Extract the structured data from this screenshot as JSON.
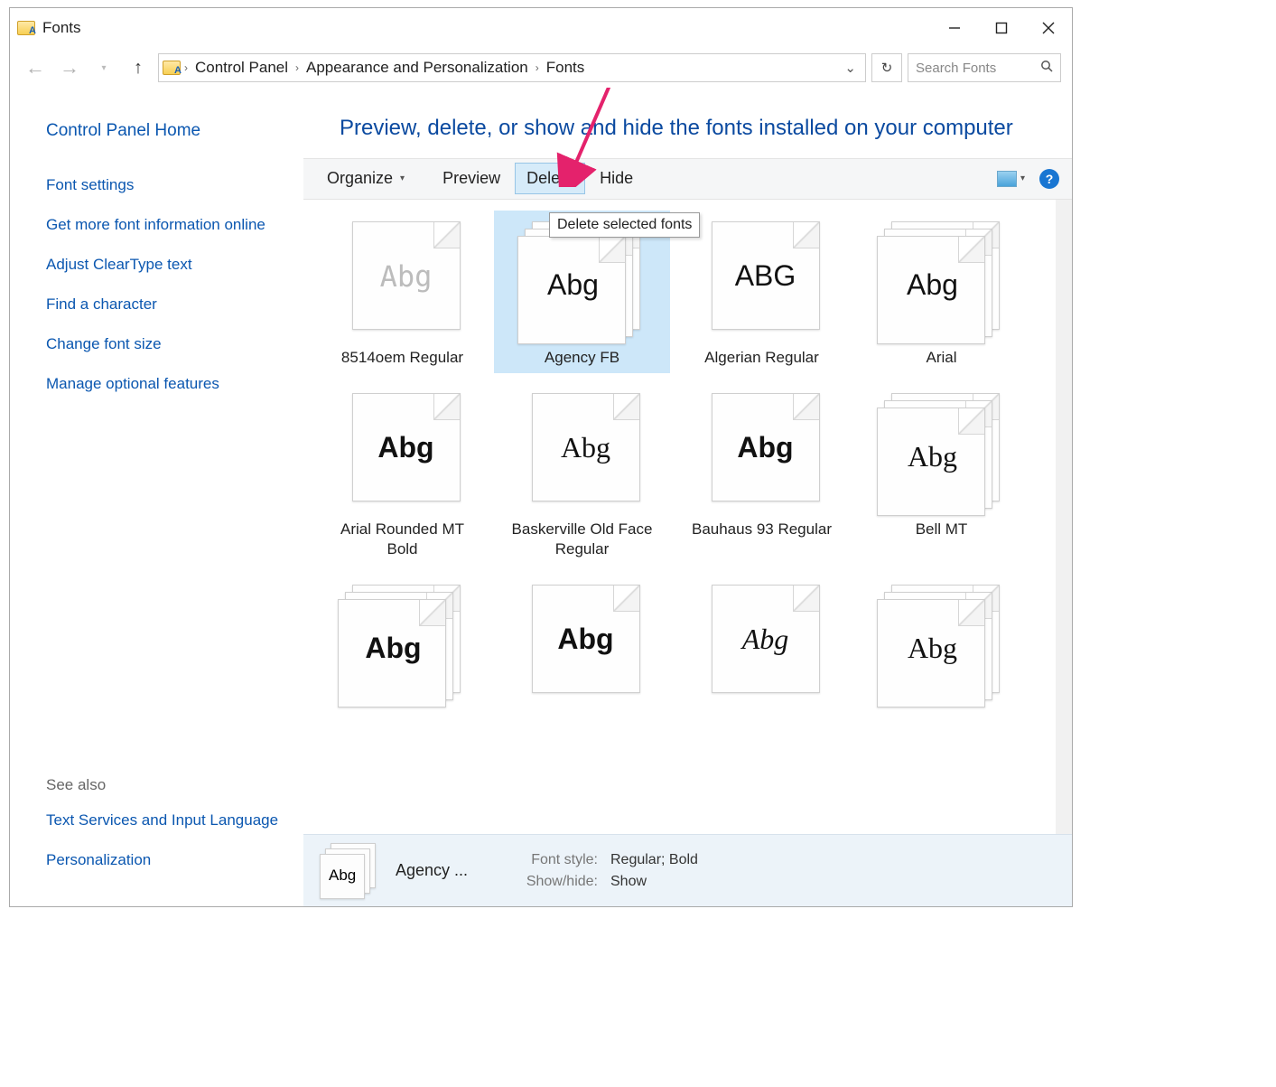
{
  "window": {
    "title": "Fonts"
  },
  "breadcrumbs": [
    "Control Panel",
    "Appearance and Personalization",
    "Fonts"
  ],
  "search": {
    "placeholder": "Search Fonts"
  },
  "page_heading": "Preview, delete, or show and hide the fonts installed on your computer",
  "sidebar": {
    "home": "Control Panel Home",
    "links": [
      "Font settings",
      "Get more font information online",
      "Adjust ClearType text",
      "Find a character",
      "Change font size",
      "Manage optional features"
    ],
    "see_also_label": "See also",
    "see_also": [
      "Text Services and Input Language",
      "Personalization"
    ]
  },
  "toolbar": {
    "organize": "Organize",
    "preview": "Preview",
    "delete": "Delete",
    "hide": "Hide"
  },
  "tooltip": "Delete selected fonts",
  "fonts": [
    {
      "name": "8514oem Regular",
      "sample": "Abg",
      "stack": false,
      "dim": true
    },
    {
      "name": "Agency FB",
      "sample": "Abg",
      "stack": true,
      "selected": true
    },
    {
      "name": "Algerian Regular",
      "sample": "ABG",
      "stack": false
    },
    {
      "name": "Arial",
      "sample": "Abg",
      "stack": true
    },
    {
      "name": "Arial Rounded MT Bold",
      "sample": "Abg",
      "stack": false,
      "bold": true
    },
    {
      "name": "Baskerville Old Face Regular",
      "sample": "Abg",
      "stack": false,
      "serif": true
    },
    {
      "name": "Bauhaus 93 Regular",
      "sample": "Abg",
      "stack": false,
      "bold": true
    },
    {
      "name": "Bell MT",
      "sample": "Abg",
      "stack": true,
      "serif": true
    },
    {
      "name": "",
      "sample": "Abg",
      "stack": true,
      "bold": true
    },
    {
      "name": "",
      "sample": "Abg",
      "stack": false,
      "bold": true
    },
    {
      "name": "",
      "sample": "Abg",
      "stack": false,
      "italic": true
    },
    {
      "name": "",
      "sample": "Abg",
      "stack": true,
      "serif": true
    }
  ],
  "details": {
    "name": "Agency ...",
    "font_style_label": "Font style:",
    "font_style": "Regular; Bold",
    "show_hide_label": "Show/hide:",
    "show_hide": "Show"
  }
}
